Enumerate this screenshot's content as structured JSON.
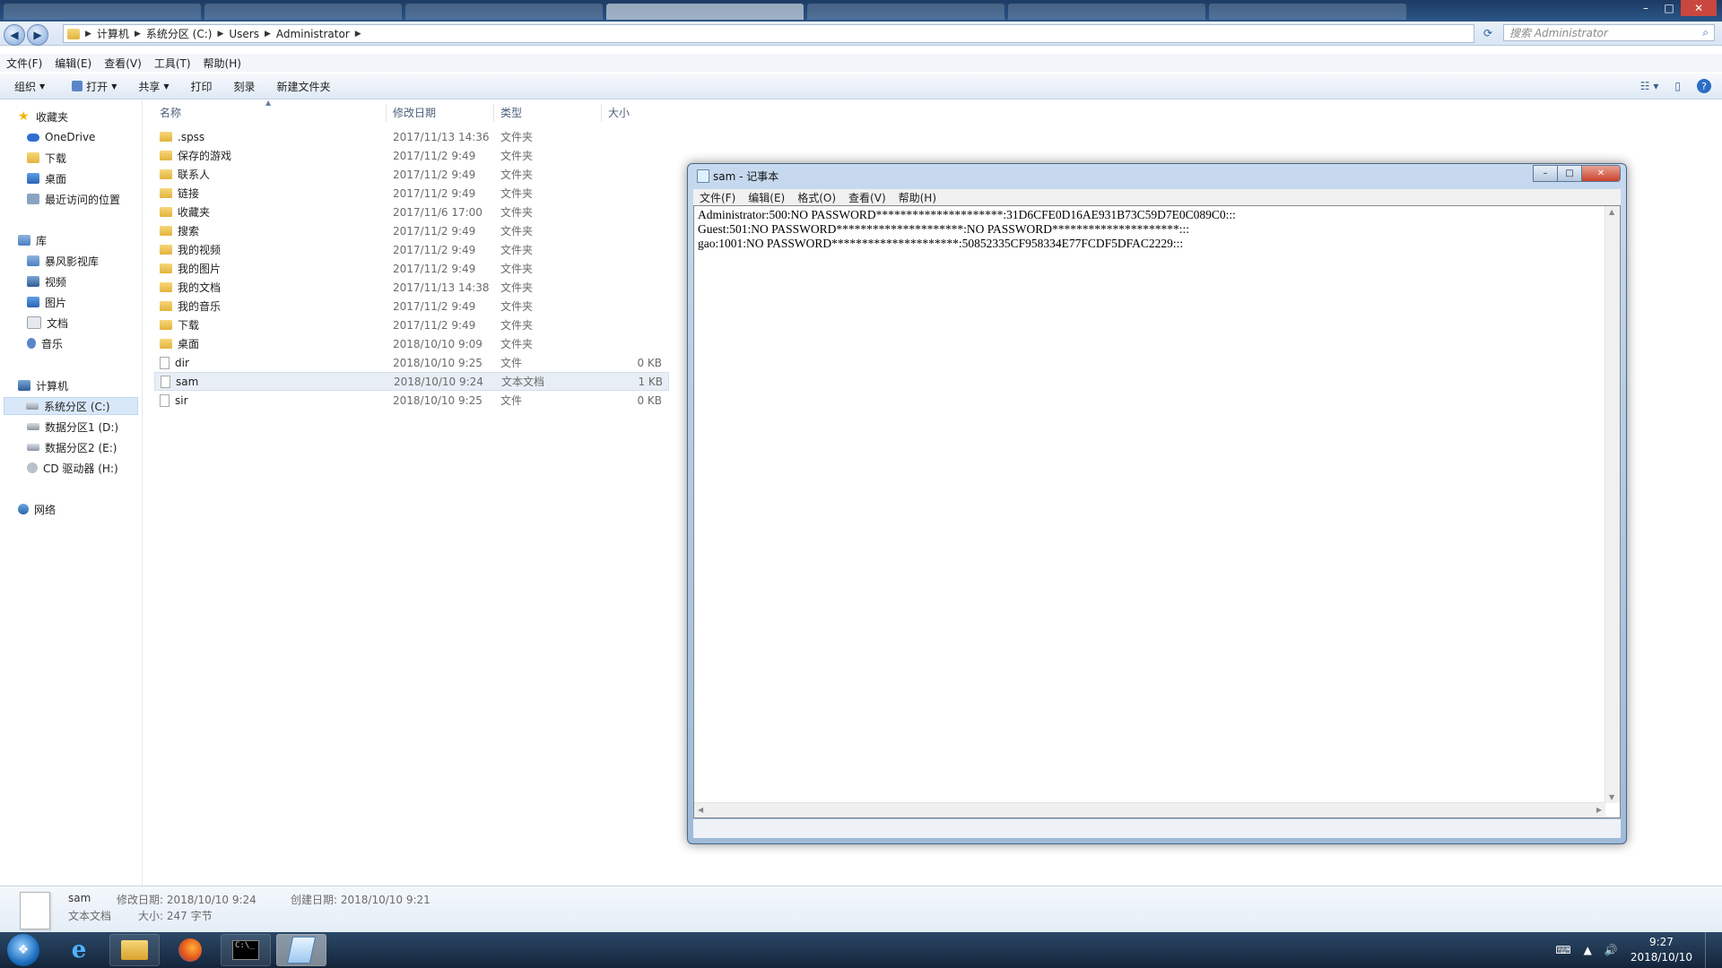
{
  "window_controls": {
    "minimize": "–",
    "maximize": "□",
    "close": "✕"
  },
  "address": {
    "segments": [
      "计算机",
      "系统分区 (C:)",
      "Users",
      "Administrator"
    ],
    "search_placeholder": "搜索 Administrator"
  },
  "menubar": [
    "文件(F)",
    "编辑(E)",
    "查看(V)",
    "工具(T)",
    "帮助(H)"
  ],
  "commands": [
    "组织",
    "打开",
    "共享",
    "打印",
    "刻录",
    "新建文件夹"
  ],
  "nav": {
    "favorites": {
      "label": "收藏夹",
      "items": [
        "OneDrive",
        "下载",
        "桌面",
        "最近访问的位置"
      ]
    },
    "libraries": {
      "label": "库",
      "items": [
        "暴风影视库",
        "视频",
        "图片",
        "文档",
        "音乐"
      ]
    },
    "computer": {
      "label": "计算机",
      "items": [
        "系统分区 (C:)",
        "数据分区1 (D:)",
        "数据分区2 (E:)",
        "CD 驱动器 (H:)"
      ]
    },
    "network": {
      "label": "网络"
    }
  },
  "columns": {
    "name": "名称",
    "date": "修改日期",
    "type": "类型",
    "size": "大小"
  },
  "files": [
    {
      "name": ".spss",
      "date": "2017/11/13 14:36",
      "type": "文件夹",
      "size": "",
      "kind": "folder"
    },
    {
      "name": "保存的游戏",
      "date": "2017/11/2 9:49",
      "type": "文件夹",
      "size": "",
      "kind": "folder"
    },
    {
      "name": "联系人",
      "date": "2017/11/2 9:49",
      "type": "文件夹",
      "size": "",
      "kind": "folder"
    },
    {
      "name": "链接",
      "date": "2017/11/2 9:49",
      "type": "文件夹",
      "size": "",
      "kind": "folder"
    },
    {
      "name": "收藏夹",
      "date": "2017/11/6 17:00",
      "type": "文件夹",
      "size": "",
      "kind": "folder"
    },
    {
      "name": "搜索",
      "date": "2017/11/2 9:49",
      "type": "文件夹",
      "size": "",
      "kind": "folder"
    },
    {
      "name": "我的视频",
      "date": "2017/11/2 9:49",
      "type": "文件夹",
      "size": "",
      "kind": "folder"
    },
    {
      "name": "我的图片",
      "date": "2017/11/2 9:49",
      "type": "文件夹",
      "size": "",
      "kind": "folder"
    },
    {
      "name": "我的文档",
      "date": "2017/11/13 14:38",
      "type": "文件夹",
      "size": "",
      "kind": "folder"
    },
    {
      "name": "我的音乐",
      "date": "2017/11/2 9:49",
      "type": "文件夹",
      "size": "",
      "kind": "folder"
    },
    {
      "name": "下载",
      "date": "2017/11/2 9:49",
      "type": "文件夹",
      "size": "",
      "kind": "folder"
    },
    {
      "name": "桌面",
      "date": "2018/10/10 9:09",
      "type": "文件夹",
      "size": "",
      "kind": "folder"
    },
    {
      "name": "dir",
      "date": "2018/10/10 9:25",
      "type": "文件",
      "size": "0 KB",
      "kind": "file"
    },
    {
      "name": "sam",
      "date": "2018/10/10 9:24",
      "type": "文本文档",
      "size": "1 KB",
      "kind": "file"
    },
    {
      "name": "sir",
      "date": "2018/10/10 9:25",
      "type": "文件",
      "size": "0 KB",
      "kind": "file"
    }
  ],
  "details": {
    "name": "sam",
    "type": "文本文档",
    "modified": "修改日期: 2018/10/10 9:24",
    "created": "创建日期: 2018/10/10 9:21",
    "size": "大小: 247 字节"
  },
  "notepad": {
    "title": "sam - 记事本",
    "menu": [
      "文件(F)",
      "编辑(E)",
      "格式(O)",
      "查看(V)",
      "帮助(H)"
    ],
    "content": "Administrator:500:NO PASSWORD*********************:31D6CFE0D16AE931B73C59D7E0C089C0:::\nGuest:501:NO PASSWORD*********************:NO PASSWORD*********************:::\ngao:1001:NO PASSWORD*********************:50852335CF958334E77FCDF5DFAC2229:::"
  },
  "clock": {
    "time": "9:27",
    "date": "2018/10/10"
  }
}
